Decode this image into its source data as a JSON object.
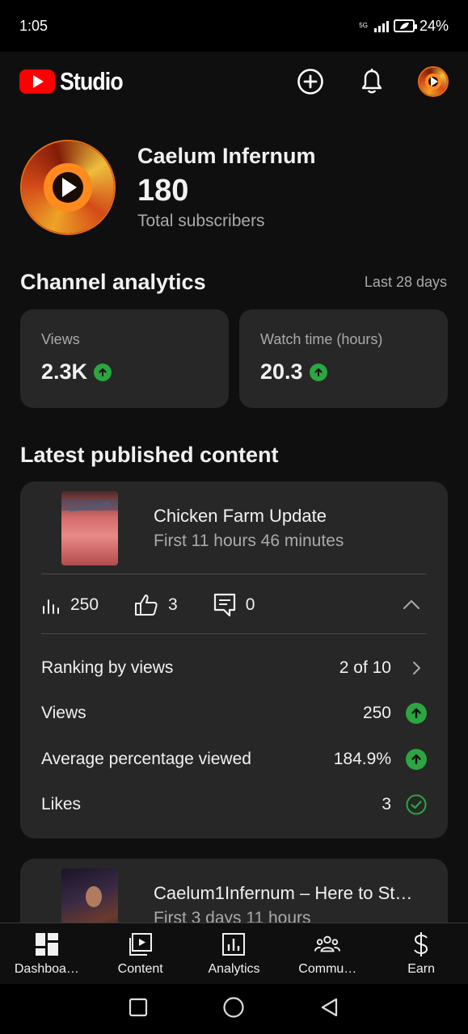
{
  "status_bar": {
    "time": "1:05",
    "network": "5G",
    "battery": "24%"
  },
  "header": {
    "brand": "Studio"
  },
  "channel": {
    "name": "Caelum Infernum",
    "subscribers": "180",
    "subscribers_label": "Total subscribers"
  },
  "analytics": {
    "title": "Channel analytics",
    "range": "Last 28 days",
    "cards": [
      {
        "label": "Views",
        "value": "2.3K"
      },
      {
        "label": "Watch time (hours)",
        "value": "20.3"
      }
    ]
  },
  "latest": {
    "title": "Latest published content",
    "videos": [
      {
        "title": "Chicken Farm Update",
        "subtitle": "First 11 hours 46 minutes",
        "views": "250",
        "likes": "3",
        "comments": "0",
        "details": [
          {
            "label": "Ranking by views",
            "value": "2 of 10"
          },
          {
            "label": "Views",
            "value": "250"
          },
          {
            "label": "Average percentage viewed",
            "value": "184.9%"
          },
          {
            "label": "Likes",
            "value": "3"
          }
        ]
      },
      {
        "title": "Caelum1Infernum – Here to St…",
        "subtitle": "First 3 days 11 hours"
      }
    ]
  },
  "nav": {
    "items": [
      {
        "label": "Dashboa…",
        "icon": "dashboard-icon"
      },
      {
        "label": "Content",
        "icon": "content-icon"
      },
      {
        "label": "Analytics",
        "icon": "analytics-icon"
      },
      {
        "label": "Commu…",
        "icon": "community-icon"
      },
      {
        "label": "Earn",
        "icon": "dollar-icon"
      }
    ]
  },
  "colors": {
    "background": "#0f0f0f",
    "card": "#272727",
    "accent_red": "#ff0000",
    "positive_green": "#2ba640",
    "muted_text": "#aaaaaa"
  }
}
